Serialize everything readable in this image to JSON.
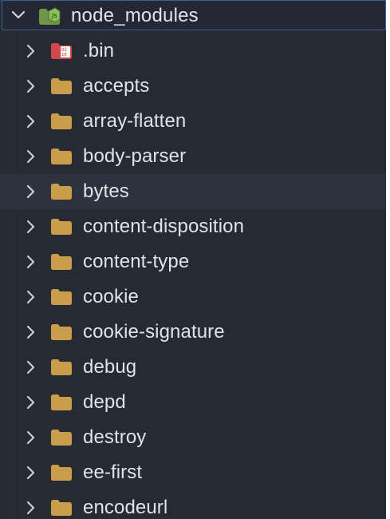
{
  "explorer": {
    "root": {
      "label": "node_modules",
      "chevron_icon": "chevron-down-icon",
      "folder_icon": "node-folder-icon"
    },
    "items": [
      {
        "label": ".bin",
        "icon": "binary-folder-icon"
      },
      {
        "label": "accepts",
        "icon": "folder-icon"
      },
      {
        "label": "array-flatten",
        "icon": "folder-icon"
      },
      {
        "label": "body-parser",
        "icon": "folder-icon"
      },
      {
        "label": "bytes",
        "icon": "folder-icon",
        "hovered": true
      },
      {
        "label": "content-disposition",
        "icon": "folder-icon"
      },
      {
        "label": "content-type",
        "icon": "folder-icon"
      },
      {
        "label": "cookie",
        "icon": "folder-icon"
      },
      {
        "label": "cookie-signature",
        "icon": "folder-icon"
      },
      {
        "label": "debug",
        "icon": "folder-icon"
      },
      {
        "label": "depd",
        "icon": "folder-icon"
      },
      {
        "label": "destroy",
        "icon": "folder-icon"
      },
      {
        "label": "ee-first",
        "icon": "folder-icon"
      },
      {
        "label": "encodeurl",
        "icon": "folder-icon"
      }
    ],
    "colors": {
      "background": "#252a33",
      "text": "#dfe3ea",
      "folder": "#c99d4b",
      "node_green": "#8bbf58",
      "binary_red": "#d2474b",
      "focus_border": "#3d5f93",
      "hover_row": "#2d333d"
    }
  }
}
